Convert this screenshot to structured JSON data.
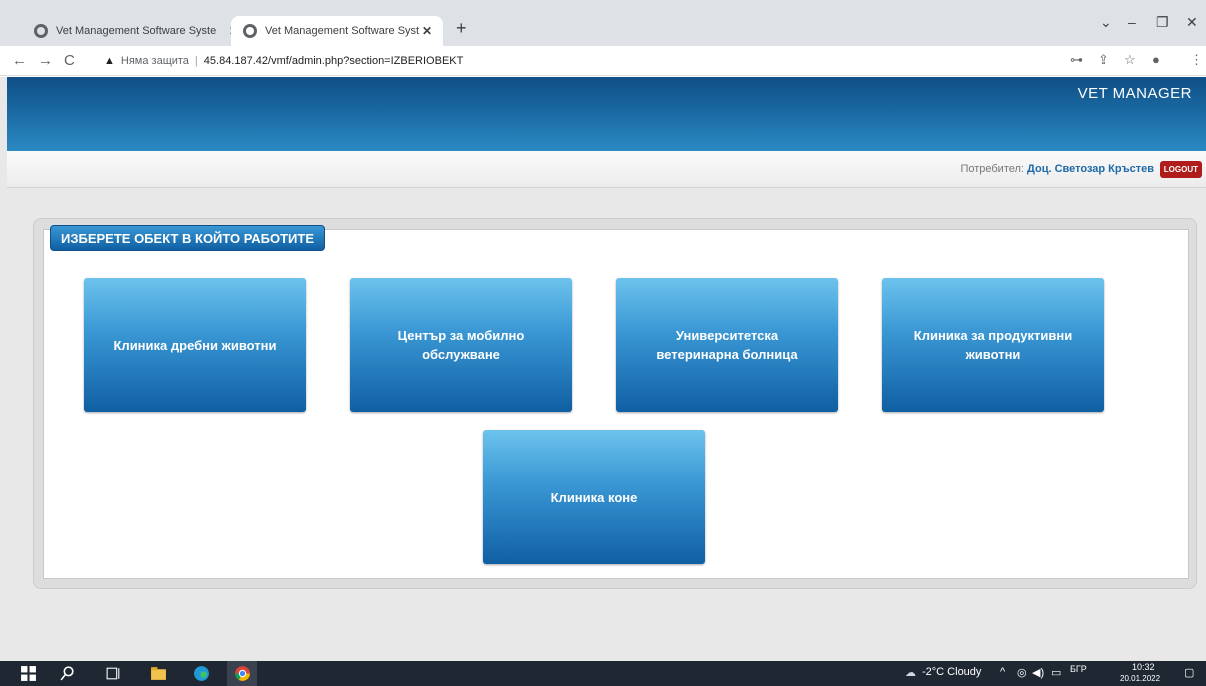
{
  "browser": {
    "tabs": [
      {
        "title": "Vet Management Software Syste",
        "active": false
      },
      {
        "title": "Vet Management Software Syste",
        "active": true
      }
    ],
    "new_tab": "+",
    "security_label": "Няма защита",
    "url": "45.84.187.42/vmf/admin.php?section=IZBERIOBEKT"
  },
  "header": {
    "brand": "VET MANAGER"
  },
  "userbar": {
    "user_label": "Потребител: ",
    "user_name": "Доц. Светозар Кръстев",
    "logout_label": "LOGOUT"
  },
  "panel": {
    "title": "ИЗБЕРЕТЕ ОБЕКТ В КОЙТО РАБОТИТЕ",
    "objects": [
      "Клиника дребни животни",
      "Център за мобилно обслужване",
      "Университетска ветеринарна болница",
      "Клиника за продуктивни животни",
      "Клиника коне"
    ]
  },
  "taskbar": {
    "weather": "-2°C  Cloudy",
    "lang": "БГР",
    "time": "10:32",
    "date": "20.01.2022"
  },
  "colors": {
    "banner": "#1d6ea8",
    "button": "#3a97d4",
    "logout": "#b01c1c",
    "username": "#1f6aa8"
  }
}
